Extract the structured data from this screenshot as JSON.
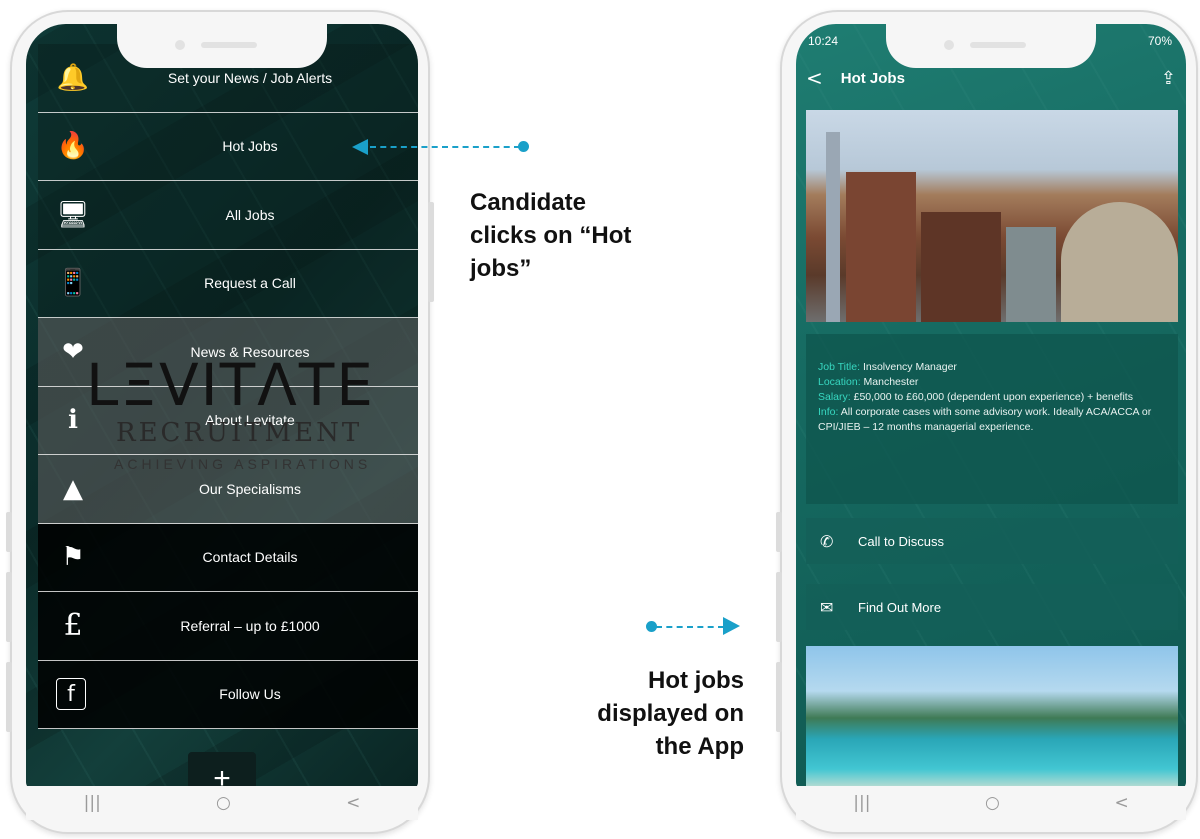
{
  "left_phone": {
    "menu": [
      {
        "icon": "bell-icon",
        "glyph": "🔔",
        "label": "Set your News / Job Alerts"
      },
      {
        "icon": "flame-icon",
        "glyph": "🔥",
        "label": "Hot Jobs"
      },
      {
        "icon": "job-search-icon",
        "glyph": "🖥",
        "label": "All Jobs"
      },
      {
        "icon": "phone-ringing-icon",
        "glyph": "📱",
        "label": "Request a Call"
      },
      {
        "icon": "book-heart-icon",
        "glyph": "❤",
        "label": "News & Resources"
      },
      {
        "icon": "info-icon",
        "glyph": "ℹ",
        "label": "About Levitate"
      },
      {
        "icon": "specialisms-icon",
        "glyph": "▲",
        "label": "Our Specialisms"
      },
      {
        "icon": "uk-map-icon",
        "glyph": "⚑",
        "label": "Contact Details"
      },
      {
        "icon": "pound-icon",
        "glyph": "£",
        "label": "Referral – up to £1000"
      },
      {
        "icon": "facebook-icon",
        "glyph": "f",
        "label": "Follow Us"
      }
    ],
    "logo": {
      "word": "LΞVITΛTE",
      "sub": "RECRUITMENT",
      "tag": "ACHIEVING ASPIRATIONS"
    },
    "plus_label": "+",
    "nav": {
      "recent": "|||",
      "home": "○",
      "back": "<"
    }
  },
  "right_phone": {
    "status": {
      "time": "10:24",
      "battery": "70%"
    },
    "appbar": {
      "back": "<",
      "title": "Hot Jobs",
      "share": "⇪"
    },
    "job": {
      "title_key": "Job Title:",
      "title_val": " Insolvency Manager",
      "location_key": "Location:",
      "location_val": " Manchester",
      "salary_key": "Salary:",
      "salary_val": " £50,000 to £60,000 (dependent upon experience) + benefits",
      "info_key": "Info:",
      "info_val": " All corporate cases with some advisory work. Ideally ACA/ACCA or CPI/JIEB – 12 months managerial experience."
    },
    "actions": {
      "call": "Call to Discuss",
      "more": "Find Out More"
    },
    "nav": {
      "recent": "|||",
      "home": "○",
      "back": "<"
    }
  },
  "captions": {
    "top": [
      "Candidate",
      "clicks on “Hot",
      "jobs”"
    ],
    "bottom": [
      "Hot jobs",
      "displayed on",
      "the App"
    ]
  },
  "colors": {
    "arrow": "#1aa0c9",
    "accent_key": "#37d7c0",
    "left_bg": "#0f3b38",
    "right_bg": "#1f7d72"
  }
}
